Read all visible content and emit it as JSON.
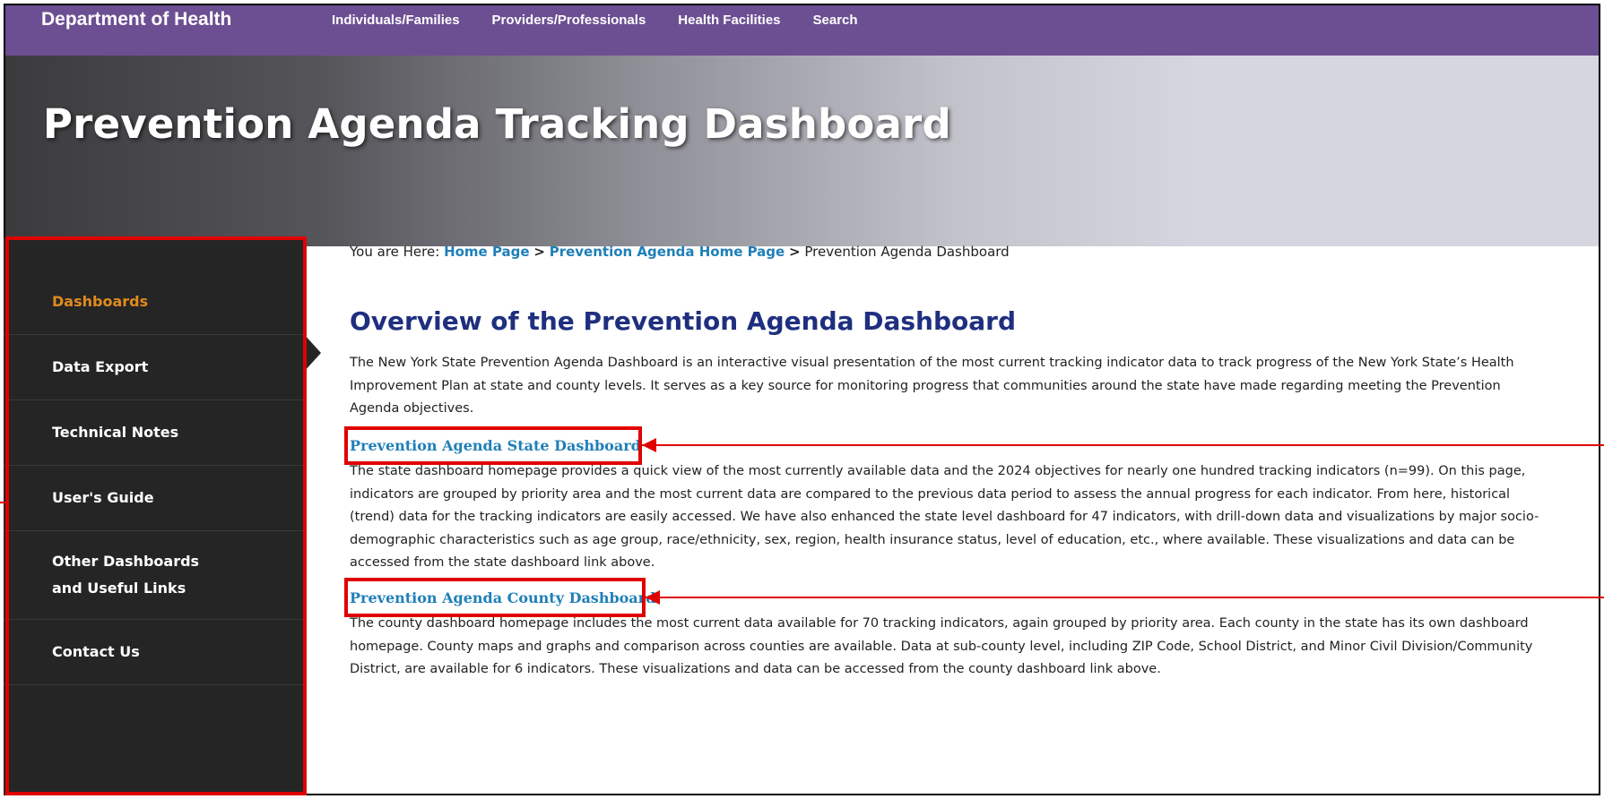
{
  "topnav": {
    "brand": "Department of Health",
    "links": [
      "Individuals/Families",
      "Providers/Professionals",
      "Health Facilities",
      "Search"
    ]
  },
  "banner": {
    "title": "Prevention Agenda Tracking Dashboard"
  },
  "sidebar": {
    "items": [
      {
        "label": "Dashboards",
        "active": true
      },
      {
        "label": "Data Export"
      },
      {
        "label": "Technical Notes"
      },
      {
        "label": "User's Guide"
      },
      {
        "label": "Other Dashboards and Useful Links"
      },
      {
        "label": "Contact Us"
      }
    ]
  },
  "breadcrumb": {
    "prefix": "You are Here:",
    "home": "Home Page",
    "sep": ">",
    "pa_home": "Prevention Agenda Home Page",
    "current": "Prevention Agenda Dashboard"
  },
  "main": {
    "title": "Overview of the Prevention Agenda Dashboard",
    "intro": "The New York State Prevention Agenda Dashboard is an interactive visual presentation of the most current tracking indicator data to track progress of the New York State’s Health Improvement Plan at state and county levels. It serves as a key source for monitoring progress that communities around the state have made regarding meeting the Prevention Agenda objectives.",
    "state_link": "Prevention Agenda State Dashboard",
    "state_text": "The state dashboard homepage provides a quick view of the most currently available data and the 2024 objectives for nearly one hundred tracking indicators (n=99). On this page, indicators are grouped by priority area and the most current data are compared to the previous data period to assess the annual progress for each indicator. From here, historical (trend) data for the tracking indicators are easily accessed. We have also enhanced the state level dashboard for 47 indicators, with drill-down data and visualizations by major socio-demographic characteristics such as age group, race/ethnicity, sex, region, health insurance status, level of education, etc., where available. These visualizations and data can be accessed from the state dashboard link above.",
    "county_link": "Prevention Agenda County Dashboard",
    "county_text": "The county dashboard homepage includes the most current data available for 70 tracking indicators, again grouped by priority area. Each county in the state has its own dashboard homepage. County maps and graphs and comparison across counties are available. Data at sub-county level, including ZIP Code, School District, and Minor Civil Division/Community District, are available for 6 indicators. These visualizations and data can be accessed from the county dashboard link above."
  },
  "colors": {
    "nav_purple": "#6c4f92",
    "sidebar_bg": "#252525",
    "active_orange": "#e08a1e",
    "link_blue": "#1f7fb8",
    "title_navy": "#1f2f7f",
    "annotation_red": "#e00000"
  }
}
